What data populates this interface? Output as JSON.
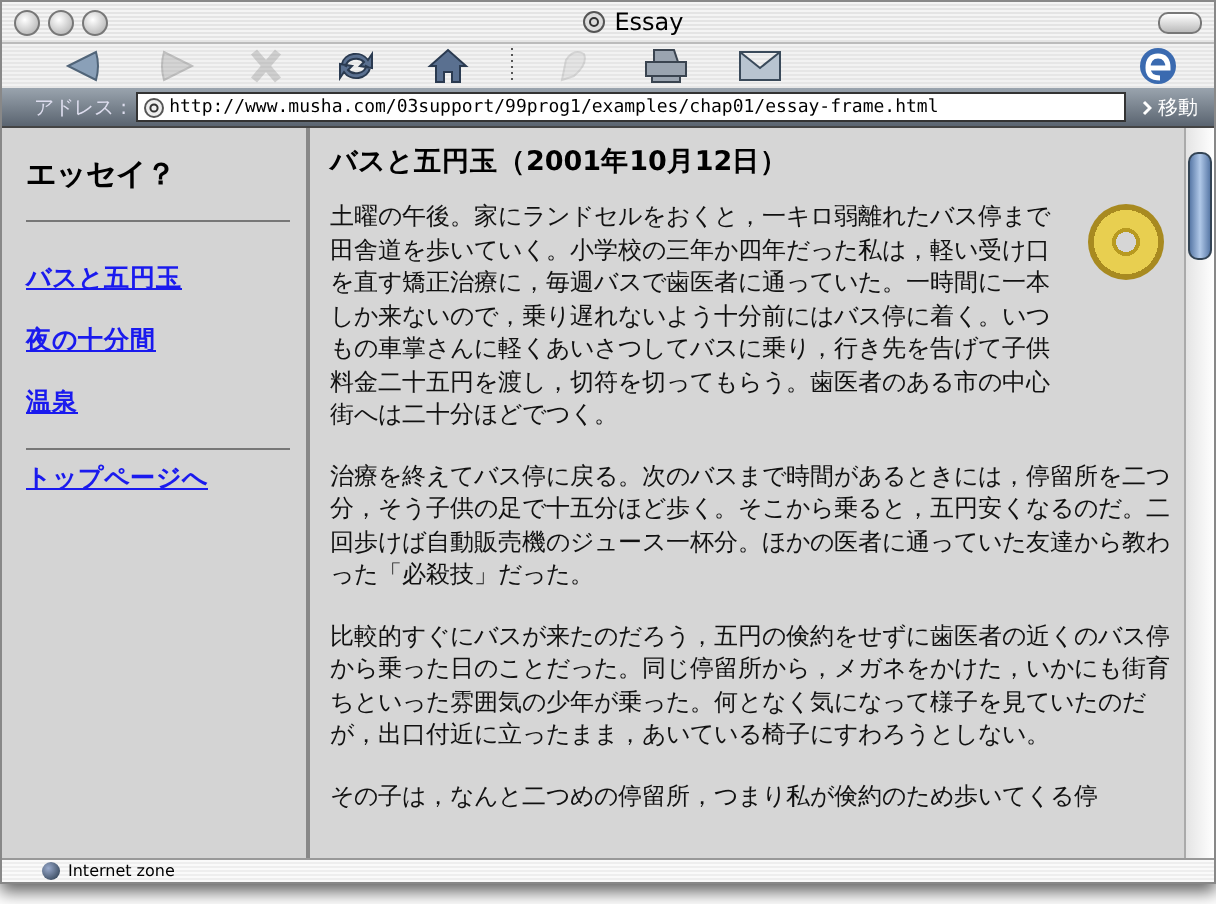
{
  "window": {
    "title": "Essay"
  },
  "toolbar": [
    {
      "kind": "back",
      "disabled": false
    },
    {
      "kind": "forward",
      "disabled": true
    },
    {
      "kind": "stop",
      "disabled": true
    },
    {
      "kind": "refresh",
      "disabled": false
    },
    {
      "kind": "home",
      "disabled": false
    },
    {
      "kind": "autofill",
      "disabled": true
    },
    {
      "kind": "print",
      "disabled": false
    },
    {
      "kind": "mail",
      "disabled": false
    }
  ],
  "address_bar": {
    "label": "アドレス :",
    "value": "http://www.musha.com/03support/99prog1/examples/chap01/essay-frame.html",
    "go": "移動"
  },
  "sidebar": {
    "title": "エッセイ？",
    "links": [
      {
        "label": "バスと五円玉"
      },
      {
        "label": "夜の十分間"
      },
      {
        "label": "温泉"
      }
    ],
    "footer_link": "トップページへ"
  },
  "article": {
    "title": "バスと五円玉（2001年10月12日）",
    "paragraphs": [
      "土曜の午後。家にランドセルをおくと，一キロ弱離れたバス停まで田舎道を歩いていく。小学校の三年か四年だった私は，軽い受け口を直す矯正治療に，毎週バスで歯医者に通っていた。一時間に一本しか来ないので，乗り遅れないよう十分前にはバス停に着く。いつもの車掌さんに軽くあいさつしてバスに乗り，行き先を告げて子供料金二十五円を渡し，切符を切ってもらう。歯医者のある市の中心街へは二十分ほどでつく。",
      "治療を終えてバス停に戻る。次のバスまで時間があるときには，停留所を二つ分，そう子供の足で十五分ほど歩く。そこから乗ると，五円安くなるのだ。二回歩けば自動販売機のジュース一杯分。ほかの医者に通っていた友達から教わった「必殺技」だった。",
      "比較的すぐにバスが来たのだろう，五円の倹約をせずに歯医者の近くのバス停から乗った日のことだった。同じ停留所から，メガネをかけた，いかにも街育ちといった雰囲気の少年が乗った。何となく気になって様子を見ていたのだが，出口付近に立ったまま，あいている椅子にすわろうとしない。",
      "その子は，なんと二つめの停留所，つまり私が倹約のため歩いてくる停"
    ]
  },
  "status_bar": {
    "text": "Internet zone"
  }
}
